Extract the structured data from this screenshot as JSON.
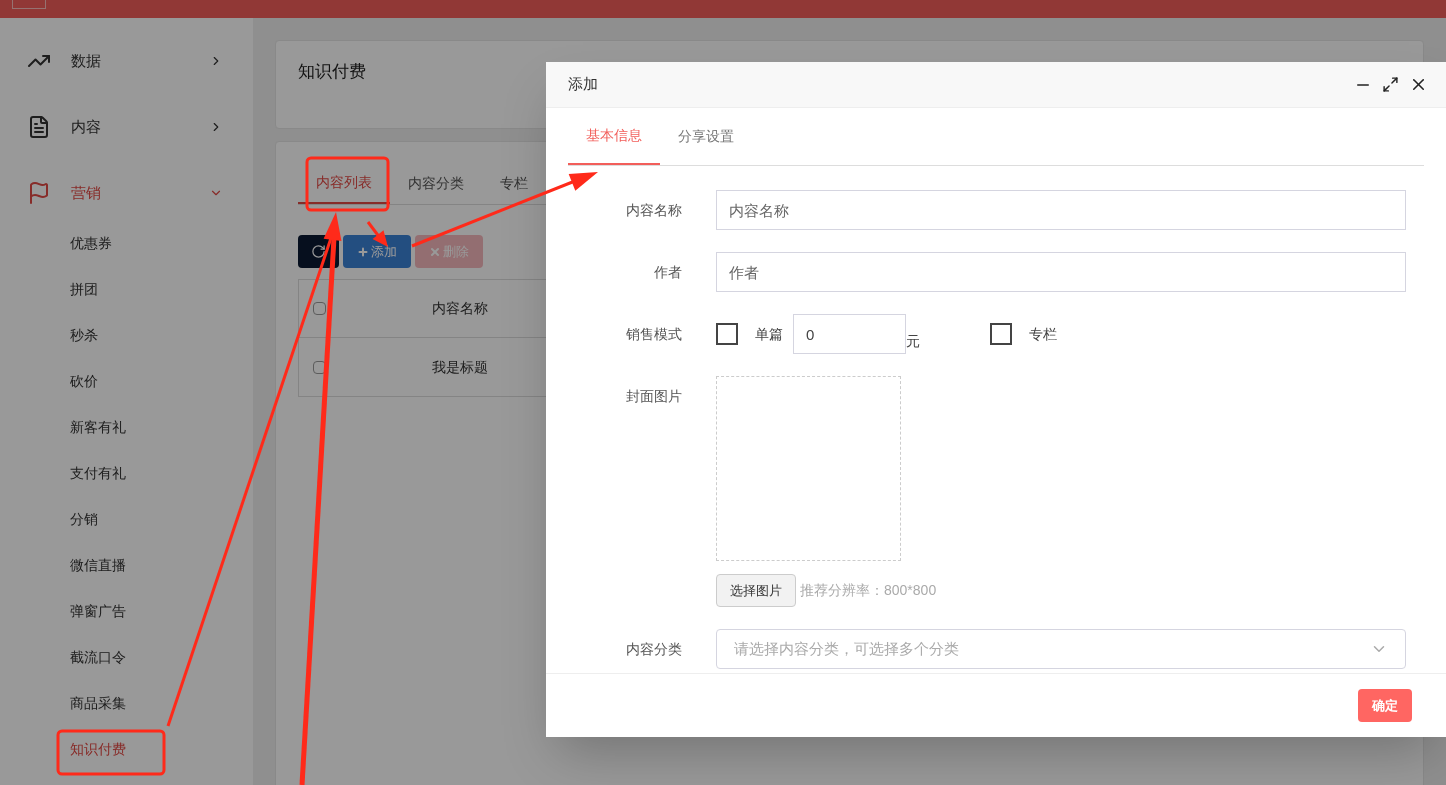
{
  "sidebar": {
    "items": [
      {
        "label": "数据",
        "expanded": false,
        "selected": false
      },
      {
        "label": "内容",
        "expanded": false,
        "selected": false
      },
      {
        "label": "营销",
        "expanded": true,
        "selected": true,
        "children": [
          {
            "label": "优惠券",
            "selected": false
          },
          {
            "label": "拼团",
            "selected": false
          },
          {
            "label": "秒杀",
            "selected": false
          },
          {
            "label": "砍价",
            "selected": false
          },
          {
            "label": "新客有礼",
            "selected": false
          },
          {
            "label": "支付有礼",
            "selected": false
          },
          {
            "label": "分销",
            "selected": false
          },
          {
            "label": "微信直播",
            "selected": false
          },
          {
            "label": "弹窗广告",
            "selected": false
          },
          {
            "label": "截流口令",
            "selected": false
          },
          {
            "label": "商品采集",
            "selected": false
          },
          {
            "label": "知识付费",
            "selected": true
          }
        ]
      }
    ]
  },
  "page": {
    "title": "知识付费",
    "tabs": [
      {
        "label": "内容列表",
        "selected": true
      },
      {
        "label": "内容分类",
        "selected": false
      },
      {
        "label": "专栏",
        "selected": false
      }
    ],
    "toolbar": [
      {
        "kind": "refresh",
        "disabled": false
      },
      {
        "kind": "add",
        "label": "添加",
        "disabled": false
      },
      {
        "kind": "delete",
        "label": "删除",
        "disabled": true
      }
    ],
    "table": {
      "header_checked": false,
      "columns": [
        "内容名称"
      ],
      "rows": [
        {
          "checked": false,
          "cells": [
            "我是标题"
          ]
        }
      ]
    }
  },
  "dialog": {
    "title": "添加",
    "tabs": [
      {
        "label": "基本信息",
        "selected": true
      },
      {
        "label": "分享设置",
        "selected": false
      }
    ],
    "fields": [
      {
        "kind": "text",
        "label": "内容名称",
        "placeholder": "内容名称"
      },
      {
        "kind": "text",
        "label": "作者",
        "placeholder": "作者"
      },
      {
        "kind": "sale_mode",
        "label": "销售模式",
        "options": [
          {
            "label": "单篇",
            "checked": false,
            "value": "0",
            "unit": "元"
          },
          {
            "label": "专栏",
            "checked": false
          }
        ]
      },
      {
        "kind": "image",
        "label": "封面图片",
        "button": "选择图片",
        "hint": "推荐分辨率：800*800"
      },
      {
        "kind": "select",
        "label": "内容分类",
        "placeholder": "请选择内容分类，可选择多个分类"
      }
    ],
    "confirm": "确定"
  }
}
